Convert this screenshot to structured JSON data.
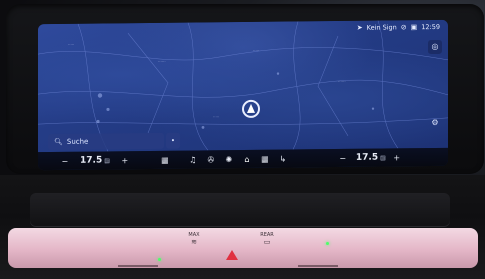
{
  "status_bar": {
    "network_label": "Kein Sign",
    "clock": "12:59"
  },
  "search": {
    "label": "Suche"
  },
  "climate": {
    "left_temp": "17.5",
    "right_temp": "17.5"
  },
  "physical_controls": {
    "max_label": "MAX",
    "rear_label": "REAR"
  },
  "colors": {
    "map_blue": "#2a4590",
    "accent_red": "#e03040",
    "trim_pink": "#e4b6c7"
  },
  "icons": [
    "navigation-settings-icon",
    "search-icon",
    "home-icon",
    "music-icon",
    "fan-icon",
    "phone-icon",
    "apps-icon",
    "back-icon",
    "position-arrow-icon",
    "hazard-icon"
  ]
}
